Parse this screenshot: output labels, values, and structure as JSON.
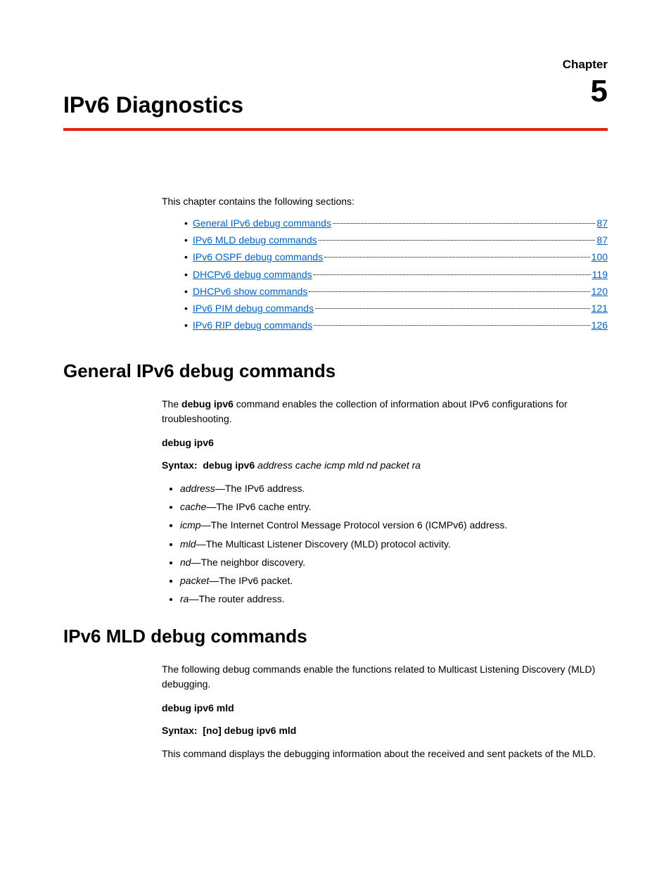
{
  "chapter": {
    "label": "Chapter",
    "number": "5",
    "title": "IPv6 Diagnostics"
  },
  "intro": "This chapter contains the following sections:",
  "toc": [
    {
      "label": "General IPv6 debug commands",
      "page": "87"
    },
    {
      "label": "IPv6 MLD debug commands",
      "page": "87"
    },
    {
      "label": "IPv6 OSPF debug commands",
      "page": "100"
    },
    {
      "label": "DHCPv6 debug commands",
      "page": "119"
    },
    {
      "label": "DHCPv6 show commands",
      "page": "120"
    },
    {
      "label": "IPv6 PIM debug commands",
      "page": "121"
    },
    {
      "label": "IPv6 RIP debug commands",
      "page": "126"
    }
  ],
  "section1": {
    "heading": "General IPv6 debug commands",
    "desc_pre": "The ",
    "desc_cmd": "debug ipv6",
    "desc_post": " command enables the collection of information about IPv6 configurations for troubleshooting.",
    "cmd_name": "debug ipv6",
    "syntax_label": "Syntax:",
    "syntax_cmd": "debug ipv6",
    "syntax_args": "address cache icmp mld nd packet ra",
    "params": [
      {
        "name": "address",
        "desc": "—The IPv6 address."
      },
      {
        "name": "cache",
        "desc": "—The IPv6 cache entry."
      },
      {
        "name": "icmp",
        "desc": "—The Internet Control Message Protocol version 6 (ICMPv6) address."
      },
      {
        "name": "mld",
        "desc": "—The Multicast Listener Discovery (MLD) protocol activity."
      },
      {
        "name": "nd",
        "desc": "—The neighbor discovery."
      },
      {
        "name": "packet",
        "desc": "—The IPv6 packet."
      },
      {
        "name": "ra",
        "desc": "—The router address."
      }
    ]
  },
  "section2": {
    "heading": "IPv6 MLD debug commands",
    "desc": "The following debug commands enable the functions related to Multicast Listening Discovery (MLD) debugging.",
    "cmd_name": "debug ipv6 mld",
    "syntax_label": "Syntax:",
    "syntax_cmd": "[no] debug ipv6 mld",
    "cmd_desc": "This command displays the debugging information about the received and sent packets of the MLD."
  }
}
